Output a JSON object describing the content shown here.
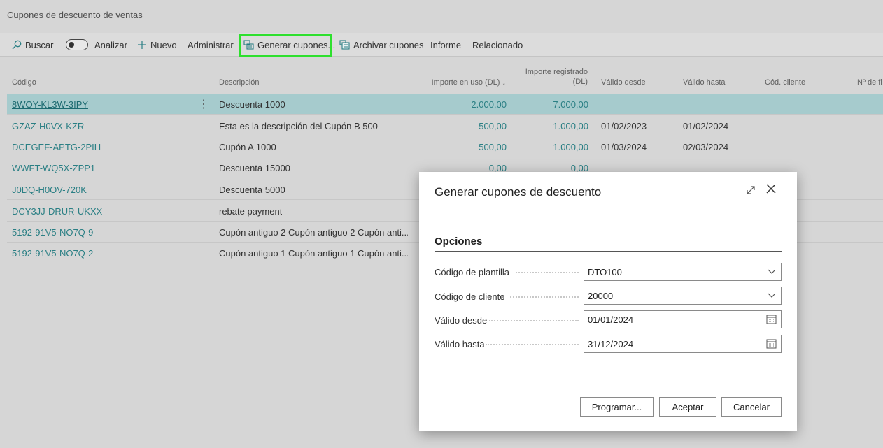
{
  "page": {
    "title": "Cupones de descuento de ventas"
  },
  "toolbar": {
    "search": "Buscar",
    "analyze": "Analizar",
    "new": "Nuevo",
    "manage": "Administrar",
    "generate": "Generar cupones...",
    "archive": "Archivar cupones",
    "report": "Informe",
    "related": "Relacionado"
  },
  "table": {
    "headers": {
      "code": "Código",
      "description": "Descripción",
      "amount_used": "Importe en uso (DL) ↓",
      "amount_registered_1": "Importe registrado",
      "amount_registered_2": "(DL)",
      "valid_from": "Válido desde",
      "valid_to": "Válido hasta",
      "customer": "Cód. cliente",
      "number": "Nº de fi"
    },
    "rows": [
      {
        "code": "8WOY-KL3W-3IPY",
        "description": "Descuenta 1000",
        "used": "2.000,00",
        "registered": "7.000,00",
        "from": "",
        "to": ""
      },
      {
        "code": "GZAZ-H0VX-KZR",
        "description": "Esta es la descripción del Cupón B 500",
        "used": "500,00",
        "registered": "1.000,00",
        "from": "01/02/2023",
        "to": "01/02/2024"
      },
      {
        "code": "DCEGEF-APTG-2PIH",
        "description": "Cupón A 1000",
        "used": "500,00",
        "registered": "1.000,00",
        "from": "01/03/2024",
        "to": "02/03/2024"
      },
      {
        "code": "WWFT-WQ5X-ZPP1",
        "description": "Descuenta 15000",
        "used": "0,00",
        "registered": "0,00",
        "from": "",
        "to": ""
      },
      {
        "code": "J0DQ-H0OV-720K",
        "description": "Descuenta 5000",
        "used": "",
        "registered": "",
        "from": "",
        "to": ""
      },
      {
        "code": "DCY3JJ-DRUR-UKXX",
        "description": "rebate payment",
        "used": "",
        "registered": "",
        "from": "",
        "to": ""
      },
      {
        "code": "5192-91V5-NO7Q-9",
        "description": "Cupón antiguo 2 Cupón antiguo 2 Cupón anti...",
        "used": "",
        "registered": "",
        "from": "",
        "to": ""
      },
      {
        "code": "5192-91V5-NO7Q-2",
        "description": "Cupón antiguo 1 Cupón antiguo 1 Cupón anti...",
        "used": "",
        "registered": "",
        "from": "",
        "to": ""
      }
    ]
  },
  "dialog": {
    "title": "Generar cupones de descuento",
    "section": "Opciones",
    "fields": {
      "template_label": "Código de plantilla",
      "template_value": "DTO100",
      "customer_label": "Código de cliente",
      "customer_value": "20000",
      "from_label": "Válido desde",
      "from_value": "01/01/2024",
      "to_label": "Válido hasta",
      "to_value": "31/12/2024"
    },
    "buttons": {
      "schedule": "Programar...",
      "ok": "Aceptar",
      "cancel": "Cancelar"
    }
  },
  "colors": {
    "accent": "#2a7f84",
    "selected_row": "#a6cbcd",
    "highlight": "#2ee02e"
  }
}
